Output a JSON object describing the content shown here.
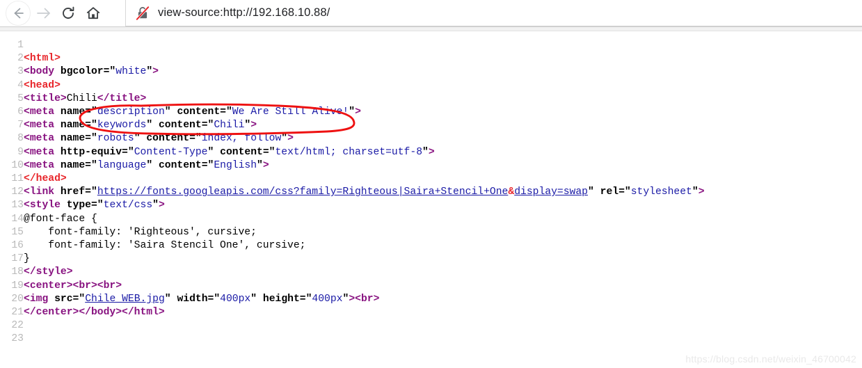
{
  "browser": {
    "nav": {
      "back_label": "Back",
      "forward_label": "Forward",
      "reload_label": "Reload",
      "home_label": "Home"
    },
    "address_bar": {
      "url": "view-source:http://192.168.10.88/",
      "security_icon": "lock-slashed-icon",
      "security_state": "Not secure"
    }
  },
  "source_view": {
    "total_lines": 23,
    "lines": [
      {
        "n": "1",
        "tokens": []
      },
      {
        "n": "2",
        "tokens": [
          {
            "t": "tgr",
            "s": "<html>"
          }
        ]
      },
      {
        "n": "3",
        "tokens": [
          {
            "t": "tg",
            "s": "<body"
          },
          {
            "t": "tx",
            "s": " "
          },
          {
            "t": "at",
            "s": "bgcolor"
          },
          {
            "t": "at",
            "s": "=\""
          },
          {
            "t": "va",
            "s": "white"
          },
          {
            "t": "at",
            "s": "\""
          },
          {
            "t": "tg",
            "s": ">"
          }
        ]
      },
      {
        "n": "4",
        "tokens": [
          {
            "t": "tgr",
            "s": "<head>"
          }
        ]
      },
      {
        "n": "5",
        "tokens": [
          {
            "t": "tg",
            "s": "<title>"
          },
          {
            "t": "tx",
            "s": "Chili"
          },
          {
            "t": "tg",
            "s": "</title>"
          }
        ]
      },
      {
        "n": "6",
        "tokens": [
          {
            "t": "tg",
            "s": "<meta"
          },
          {
            "t": "tx",
            "s": " "
          },
          {
            "t": "at",
            "s": "name"
          },
          {
            "t": "at",
            "s": "=\""
          },
          {
            "t": "va",
            "s": "description"
          },
          {
            "t": "at",
            "s": "\""
          },
          {
            "t": "tx",
            "s": " "
          },
          {
            "t": "at",
            "s": "content"
          },
          {
            "t": "at",
            "s": "=\""
          },
          {
            "t": "va",
            "s": "We Are Still Alive!"
          },
          {
            "t": "at",
            "s": "\""
          },
          {
            "t": "tg",
            "s": ">"
          }
        ]
      },
      {
        "n": "7",
        "tokens": [
          {
            "t": "tg",
            "s": "<meta"
          },
          {
            "t": "tx",
            "s": " "
          },
          {
            "t": "at",
            "s": "name"
          },
          {
            "t": "at",
            "s": "=\""
          },
          {
            "t": "va",
            "s": "keywords"
          },
          {
            "t": "at",
            "s": "\""
          },
          {
            "t": "tx",
            "s": " "
          },
          {
            "t": "at",
            "s": "content"
          },
          {
            "t": "at",
            "s": "=\""
          },
          {
            "t": "va",
            "s": "Chili"
          },
          {
            "t": "at",
            "s": "\""
          },
          {
            "t": "tg",
            "s": ">"
          }
        ]
      },
      {
        "n": "8",
        "tokens": [
          {
            "t": "tg",
            "s": "<meta"
          },
          {
            "t": "tx",
            "s": " "
          },
          {
            "t": "at",
            "s": "name"
          },
          {
            "t": "at",
            "s": "=\""
          },
          {
            "t": "va",
            "s": "robots"
          },
          {
            "t": "at",
            "s": "\""
          },
          {
            "t": "tx",
            "s": " "
          },
          {
            "t": "at",
            "s": "content"
          },
          {
            "t": "at",
            "s": "=\""
          },
          {
            "t": "va",
            "s": "index, follow"
          },
          {
            "t": "at",
            "s": "\""
          },
          {
            "t": "tg",
            "s": ">"
          }
        ]
      },
      {
        "n": "9",
        "tokens": [
          {
            "t": "tg",
            "s": "<meta"
          },
          {
            "t": "tx",
            "s": " "
          },
          {
            "t": "at",
            "s": "http-equiv"
          },
          {
            "t": "at",
            "s": "=\""
          },
          {
            "t": "va",
            "s": "Content-Type"
          },
          {
            "t": "at",
            "s": "\""
          },
          {
            "t": "tx",
            "s": " "
          },
          {
            "t": "at",
            "s": "content"
          },
          {
            "t": "at",
            "s": "=\""
          },
          {
            "t": "va",
            "s": "text/html; charset=utf-8"
          },
          {
            "t": "at",
            "s": "\""
          },
          {
            "t": "tg",
            "s": ">"
          }
        ]
      },
      {
        "n": "10",
        "tokens": [
          {
            "t": "tg",
            "s": "<meta"
          },
          {
            "t": "tx",
            "s": " "
          },
          {
            "t": "at",
            "s": "name"
          },
          {
            "t": "at",
            "s": "=\""
          },
          {
            "t": "va",
            "s": "language"
          },
          {
            "t": "at",
            "s": "\""
          },
          {
            "t": "tx",
            "s": " "
          },
          {
            "t": "at",
            "s": "content"
          },
          {
            "t": "at",
            "s": "=\""
          },
          {
            "t": "va",
            "s": "English"
          },
          {
            "t": "at",
            "s": "\""
          },
          {
            "t": "tg",
            "s": ">"
          }
        ]
      },
      {
        "n": "11",
        "tokens": [
          {
            "t": "tgr",
            "s": "</head>"
          }
        ]
      },
      {
        "n": "12",
        "tokens": [
          {
            "t": "tg",
            "s": "<link"
          },
          {
            "t": "tx",
            "s": " "
          },
          {
            "t": "at",
            "s": "href"
          },
          {
            "t": "at",
            "s": "=\""
          },
          {
            "t": "lnk",
            "s": "https://fonts.googleapis.com/css?family=Righteous|Saira+Stencil+One"
          },
          {
            "t": "amp",
            "s": "&"
          },
          {
            "t": "lnk",
            "s": "display=swap"
          },
          {
            "t": "at",
            "s": "\""
          },
          {
            "t": "tx",
            "s": " "
          },
          {
            "t": "at",
            "s": "rel"
          },
          {
            "t": "at",
            "s": "=\""
          },
          {
            "t": "va",
            "s": "stylesheet"
          },
          {
            "t": "at",
            "s": "\""
          },
          {
            "t": "tg",
            "s": ">"
          }
        ]
      },
      {
        "n": "13",
        "tokens": [
          {
            "t": "tg",
            "s": "<style"
          },
          {
            "t": "tx",
            "s": " "
          },
          {
            "t": "at",
            "s": "type"
          },
          {
            "t": "at",
            "s": "=\""
          },
          {
            "t": "va",
            "s": "text/css"
          },
          {
            "t": "at",
            "s": "\""
          },
          {
            "t": "tg",
            "s": ">"
          }
        ]
      },
      {
        "n": "14",
        "tokens": [
          {
            "t": "tx",
            "s": "@font-face {"
          }
        ]
      },
      {
        "n": "15",
        "tokens": [
          {
            "t": "tx",
            "s": "    font-family: 'Righteous', cursive;"
          }
        ]
      },
      {
        "n": "16",
        "tokens": [
          {
            "t": "tx",
            "s": "    font-family: 'Saira Stencil One', cursive;"
          }
        ]
      },
      {
        "n": "17",
        "tokens": [
          {
            "t": "tx",
            "s": "}"
          }
        ]
      },
      {
        "n": "18",
        "tokens": [
          {
            "t": "tg",
            "s": "</style>"
          }
        ]
      },
      {
        "n": "19",
        "tokens": [
          {
            "t": "tg",
            "s": "<center><br><br>"
          }
        ]
      },
      {
        "n": "20",
        "tokens": [
          {
            "t": "tg",
            "s": "<img"
          },
          {
            "t": "tx",
            "s": " "
          },
          {
            "t": "at",
            "s": "src"
          },
          {
            "t": "at",
            "s": "=\""
          },
          {
            "t": "lnk",
            "s": "Chile_WEB.jpg"
          },
          {
            "t": "at",
            "s": "\""
          },
          {
            "t": "tx",
            "s": " "
          },
          {
            "t": "at",
            "s": "width"
          },
          {
            "t": "at",
            "s": "=\""
          },
          {
            "t": "va",
            "s": "400px"
          },
          {
            "t": "at",
            "s": "\""
          },
          {
            "t": "tx",
            "s": " "
          },
          {
            "t": "at",
            "s": "height"
          },
          {
            "t": "at",
            "s": "=\""
          },
          {
            "t": "va",
            "s": "400px"
          },
          {
            "t": "at",
            "s": "\""
          },
          {
            "t": "tg",
            "s": "><br>"
          }
        ]
      },
      {
        "n": "21",
        "tokens": [
          {
            "t": "tg",
            "s": "</center></body></html>"
          }
        ]
      },
      {
        "n": "22",
        "tokens": []
      },
      {
        "n": "23",
        "tokens": []
      }
    ]
  },
  "annotation": {
    "type": "hand-drawn-ellipse",
    "color": "#ee1111",
    "target_line": "7",
    "description": "Red circle around name=\"keywords\" content=\"Chili\" on line 7"
  },
  "watermark": {
    "text": "https://blog.csdn.net/weixin_46700042"
  }
}
